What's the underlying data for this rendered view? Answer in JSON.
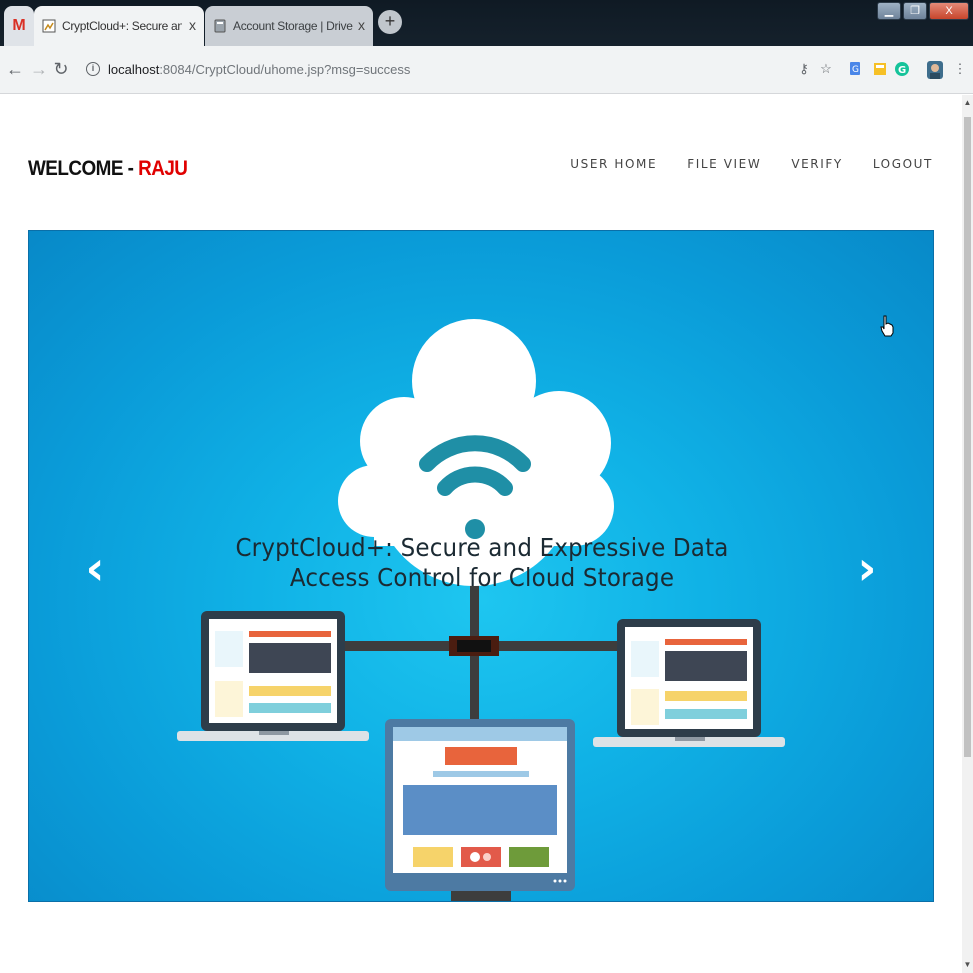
{
  "browser": {
    "tabs": [
      {
        "title": "",
        "favicon": "gmail-icon"
      },
      {
        "title": "CryptCloud+: Secure and Expressiv",
        "favicon": "page-icon",
        "close": "x"
      },
      {
        "title": "Account Storage | DriveHQ",
        "favicon": "drivehq-icon",
        "close": "x"
      }
    ],
    "new_tab": "+",
    "address": {
      "host": "localhost",
      "path": ":8084/CryptCloud/uhome.jsp?msg=success"
    }
  },
  "header": {
    "welcome_label": "WELCOME - ",
    "username": "RAJU"
  },
  "nav": {
    "items": [
      "USER HOME",
      "FILE VIEW",
      "VERIFY",
      "LOGOUT"
    ]
  },
  "carousel": {
    "caption": "CryptCloud+: Secure and Expressive Data Access Control for Cloud Storage",
    "prev": "‹",
    "next": "›"
  },
  "colors": {
    "username": "#e00000",
    "carousel_bg": "#10b2e6",
    "wifi": "#1f8fa6"
  }
}
